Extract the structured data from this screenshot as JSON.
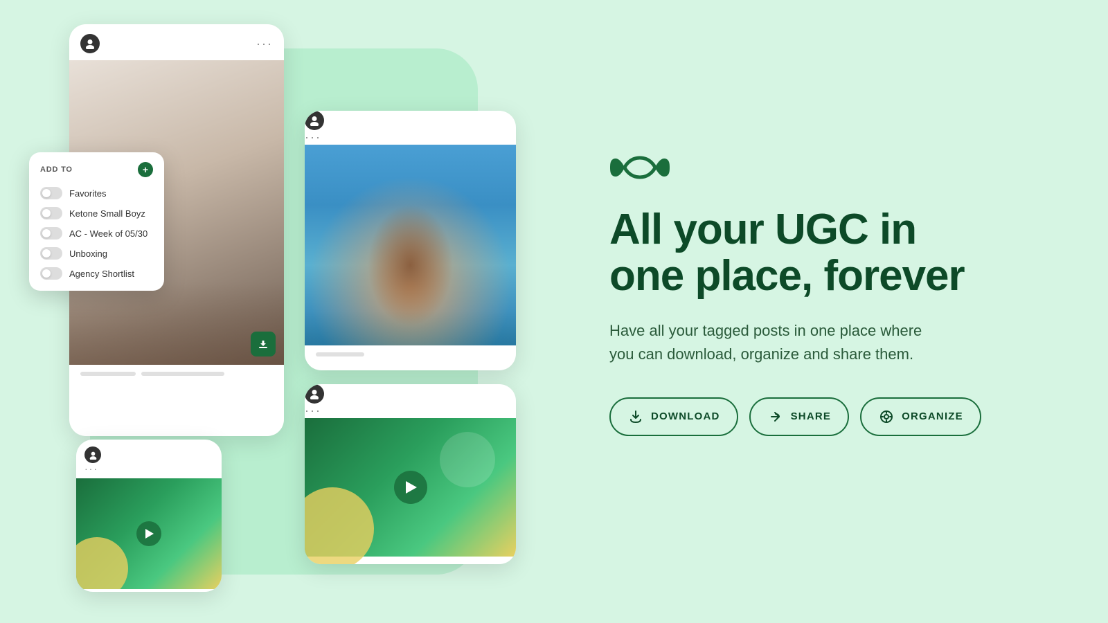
{
  "brand": {
    "logo_alt": "Infinity logo"
  },
  "left": {
    "add_to_label": "ADD TO",
    "toggles": [
      {
        "label": "Favorites"
      },
      {
        "label": "Ketone Small Boyz"
      },
      {
        "label": "AC - Week of 05/30"
      },
      {
        "label": "Unboxing"
      },
      {
        "label": "Agency Shortlist"
      }
    ]
  },
  "right": {
    "headline_line1": "All your UGC in",
    "headline_line2": "one place, forever",
    "subtext": "Have all your tagged posts in one place where you can download, organize and share them.",
    "buttons": [
      {
        "label": "DOWNLOAD",
        "icon": "download"
      },
      {
        "label": "SHARE",
        "icon": "share"
      },
      {
        "label": "ORGANIZE",
        "icon": "organize"
      }
    ]
  }
}
